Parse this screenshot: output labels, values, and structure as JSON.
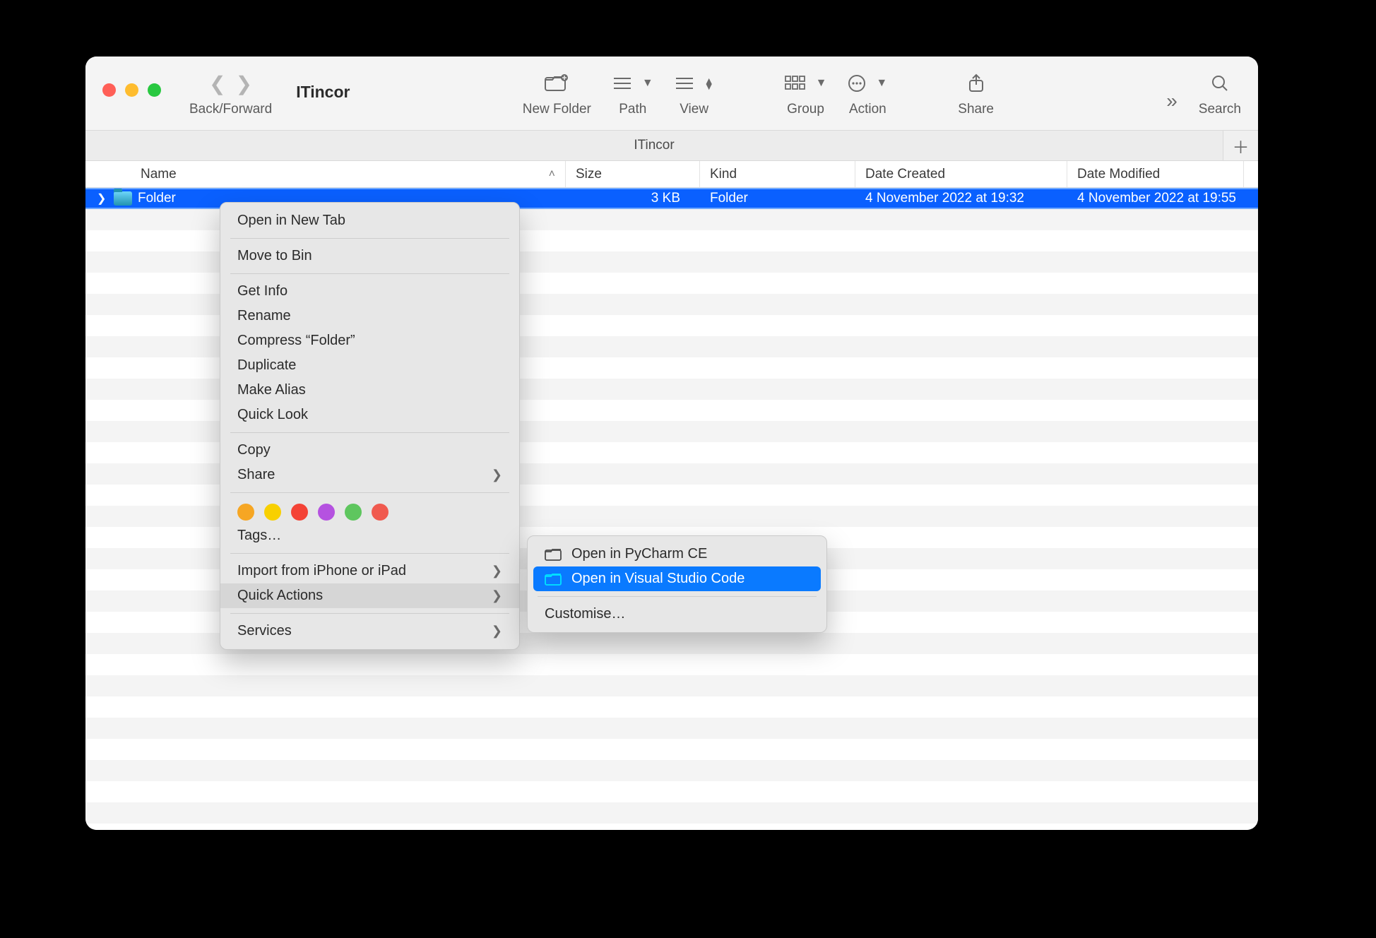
{
  "window": {
    "title": "ITincor"
  },
  "toolbar": {
    "backforward_label": "Back/Forward",
    "newfolder_label": "New Folder",
    "path_label": "Path",
    "view_label": "View",
    "group_label": "Group",
    "action_label": "Action",
    "share_label": "Share",
    "search_label": "Search"
  },
  "tabbar": {
    "tab_label": "ITincor"
  },
  "columns": {
    "name": "Name",
    "size": "Size",
    "kind": "Kind",
    "created": "Date Created",
    "modified": "Date Modified"
  },
  "rows": [
    {
      "name": "Folder",
      "size": "3 KB",
      "kind": "Folder",
      "created": "4 November 2022 at 19:32",
      "modified": "4 November 2022 at 19:55"
    }
  ],
  "context_menu": {
    "open_new_tab": "Open in New Tab",
    "move_to_bin": "Move to Bin",
    "get_info": "Get Info",
    "rename": "Rename",
    "compress": "Compress “Folder”",
    "duplicate": "Duplicate",
    "make_alias": "Make Alias",
    "quick_look": "Quick Look",
    "copy": "Copy",
    "share": "Share",
    "tags": "Tags…",
    "tag_colors": [
      "#f6a623",
      "#f8d000",
      "#f44336",
      "#b552e0",
      "#5ec65e",
      "#f05a4f"
    ],
    "import": "Import from iPhone or iPad",
    "quick_actions": "Quick Actions",
    "services": "Services"
  },
  "submenu": {
    "pycharm": "Open in PyCharm CE",
    "vscode": "Open in Visual Studio Code",
    "customise": "Customise…"
  }
}
